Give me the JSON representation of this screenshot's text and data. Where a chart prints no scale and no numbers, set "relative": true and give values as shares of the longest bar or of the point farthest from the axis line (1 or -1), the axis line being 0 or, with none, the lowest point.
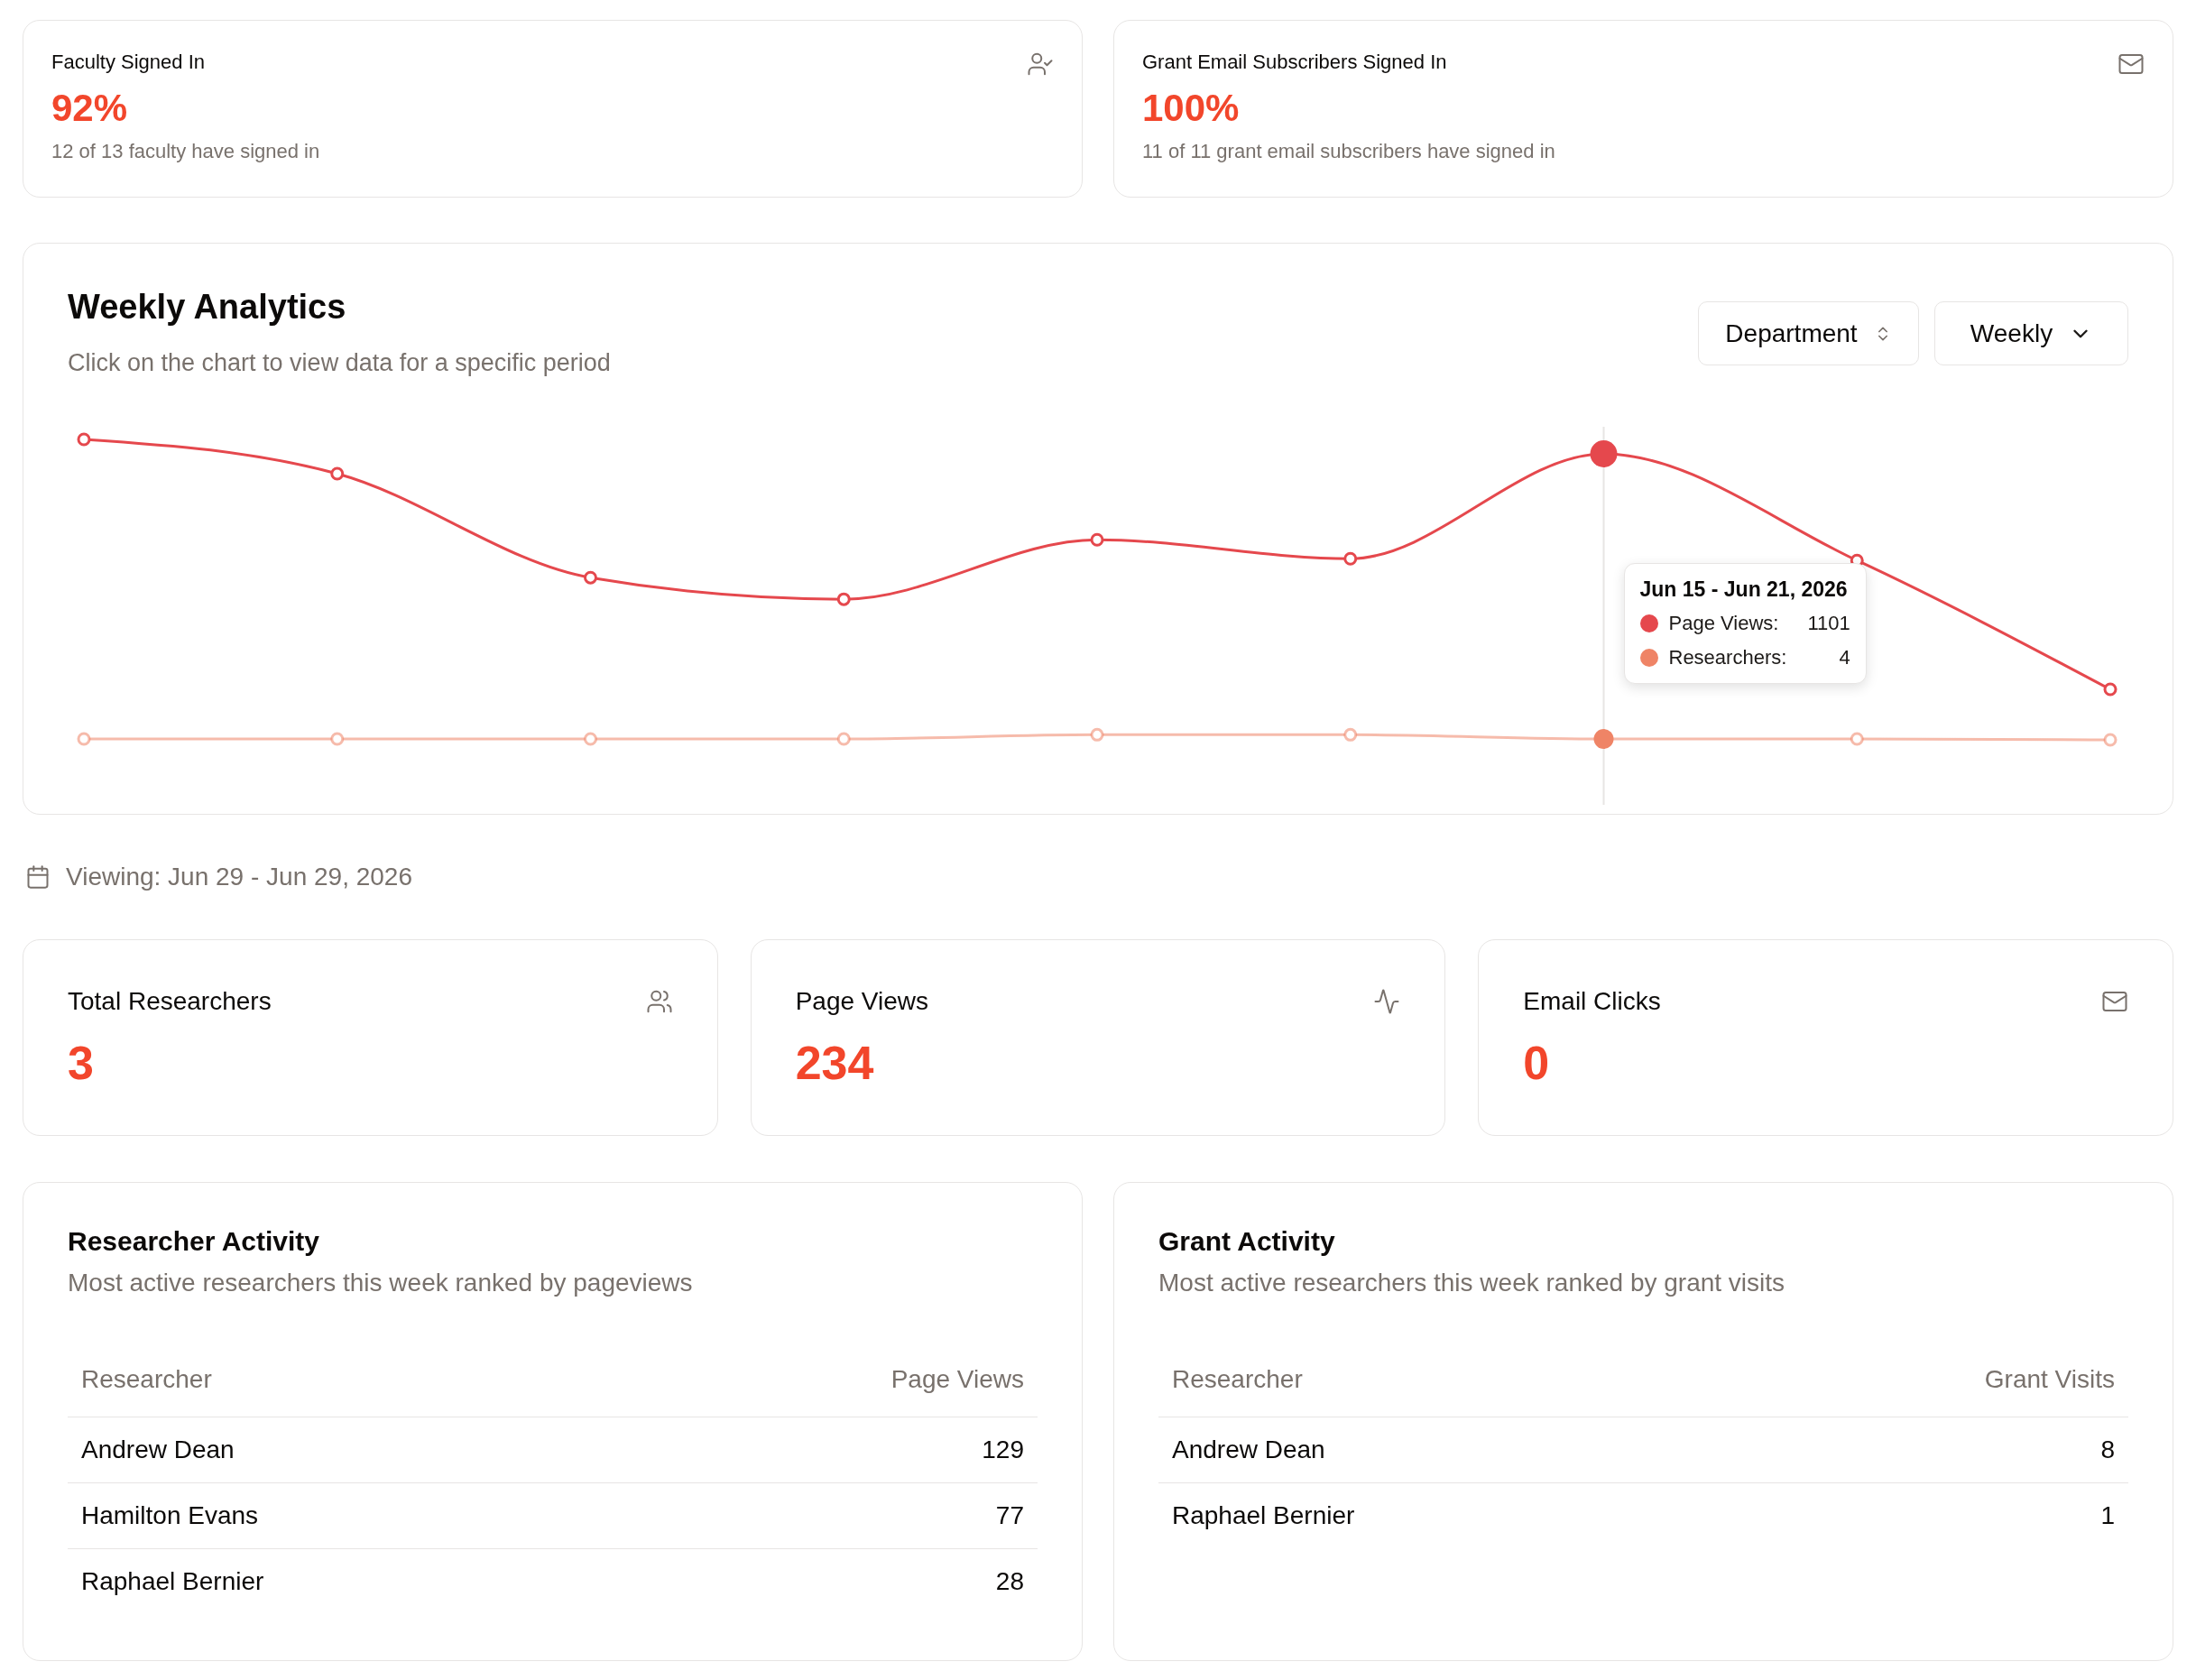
{
  "signin_cards": [
    {
      "title": "Faculty Signed In",
      "value": "92%",
      "detail": "12 of 13 faculty have signed in"
    },
    {
      "title": "Grant Email Subscribers Signed In",
      "value": "100%",
      "detail": "11 of 11 grant email subscribers have signed in"
    }
  ],
  "analytics": {
    "title": "Weekly Analytics",
    "subtitle": "Click on the chart to view data for a specific period",
    "controls": [
      {
        "kind": "select",
        "label": "Department"
      },
      {
        "kind": "dropdown",
        "label": "Weekly"
      }
    ],
    "chart_data": {
      "type": "line",
      "relative": true,
      "series": [
        {
          "color": "#e5484d",
          "marker": "circle",
          "values": [
            1,
            0.886,
            0.54,
            0.468,
            0.666,
            0.603,
            0.952,
            0.597,
            0.168
          ]
        },
        {
          "color": "#ef8466",
          "marker": "circle",
          "values": [
            0.003,
            0.003,
            0.003,
            0.003,
            0.017,
            0.017,
            0.003,
            0.003,
            0
          ]
        }
      ]
    },
    "chart_points": [
      {
        "selected": false
      },
      {
        "selected": false
      },
      {
        "selected": false
      },
      {
        "selected": false
      },
      {
        "selected": false
      },
      {
        "selected": false
      },
      {
        "selected": true
      },
      {
        "selected": false
      },
      {
        "selected": false
      }
    ],
    "tooltip": {
      "title": "Jun 15 - Jun 21, 2026",
      "rows": [
        {
          "label": "Page Views:",
          "value": "1101"
        },
        {
          "label": "Researchers:",
          "value": "4"
        }
      ]
    }
  },
  "viewing": {
    "label": "Viewing: Jun 29 - Jun 29, 2026"
  },
  "stat_cards": [
    {
      "title": "Total Researchers",
      "value": "3"
    },
    {
      "title": "Page Views",
      "value": "234"
    },
    {
      "title": "Email Clicks",
      "value": "0"
    }
  ],
  "activity_tables": [
    {
      "title": "Researcher Activity",
      "subtitle": "Most active researchers this week ranked by pageviews",
      "columns": [
        "Researcher",
        "Page Views"
      ],
      "rows": [
        [
          "Andrew Dean",
          "129"
        ],
        [
          "Hamilton Evans",
          "77"
        ],
        [
          "Raphael Bernier",
          "28"
        ]
      ]
    },
    {
      "title": "Grant Activity",
      "subtitle": "Most active researchers this week ranked by grant visits",
      "columns": [
        "Researcher",
        "Grant Visits"
      ],
      "rows": [
        [
          "Andrew Dean",
          "8"
        ],
        [
          "Raphael Bernier",
          "1"
        ]
      ]
    }
  ]
}
